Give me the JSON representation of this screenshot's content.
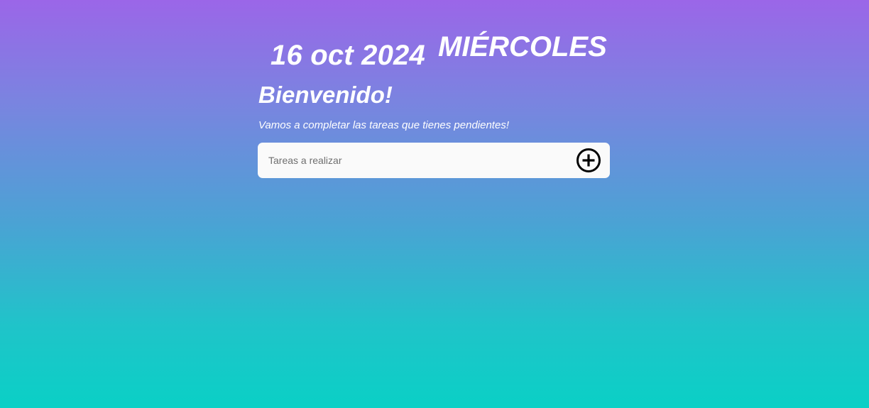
{
  "header": {
    "date": "16 oct 2024",
    "weekday": "MIÉRCOLES"
  },
  "welcome": {
    "title": "Bienvenido!",
    "subtitle": "Vamos a completar las tareas que tienes pendientes!"
  },
  "task_form": {
    "input_value": "",
    "placeholder": "Tareas a realizar",
    "add_icon": "plus-circle-icon"
  },
  "colors": {
    "gradient_top": "#9b66e8",
    "gradient_bottom": "#0ad0c6",
    "text": "#ffffff",
    "input_background": "#fafafa"
  }
}
